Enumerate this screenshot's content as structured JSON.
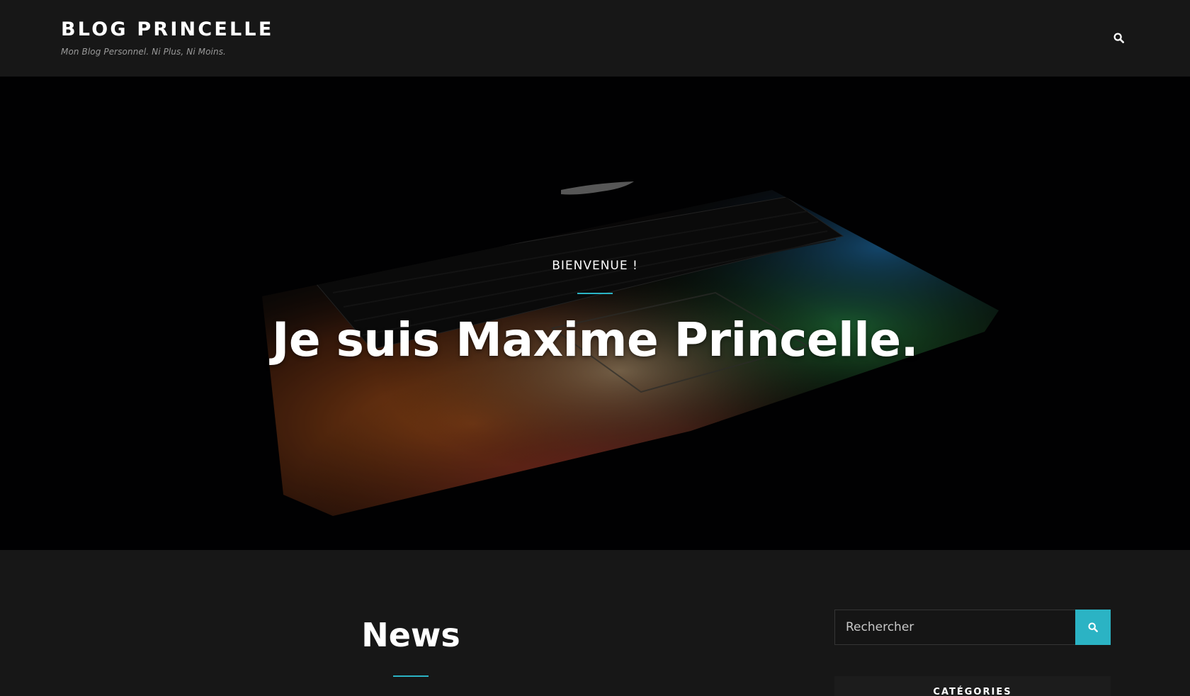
{
  "header": {
    "site_title": "BLOG PRINCELLE",
    "tagline": "Mon Blog Personnel. Ni Plus, Ni Moins.",
    "search_icon": "search-icon"
  },
  "hero": {
    "eyebrow": "BIENVENUE !",
    "title": "Je suis Maxime Princelle.",
    "accent_color": "#2bb3c4"
  },
  "main": {
    "section_title": "News"
  },
  "sidebar": {
    "search": {
      "placeholder": "Rechercher",
      "button_icon": "search-icon"
    },
    "categories_title": "CATÉGORIES"
  },
  "colors": {
    "background": "#171717",
    "accent": "#2bb3c4",
    "text": "#ffffff"
  }
}
